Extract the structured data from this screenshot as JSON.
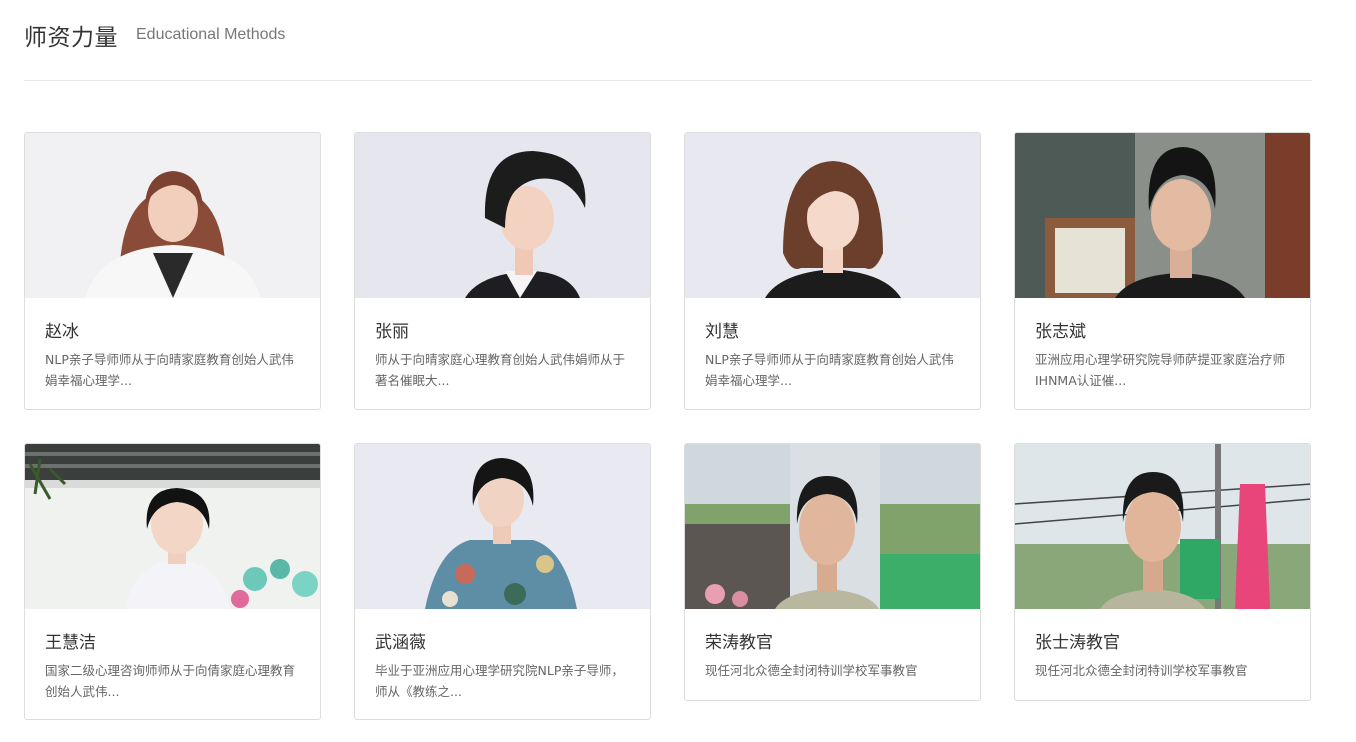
{
  "section": {
    "title": "师资力量",
    "subtitle": "Educational Methods"
  },
  "teachers": [
    {
      "name": "赵冰",
      "desc": "NLP亲子导师师从于向晴家庭教育创始人武伟娟幸福心理学..."
    },
    {
      "name": "张丽",
      "desc": "师从于向晴家庭心理教育创始人武伟娟师从于著名催眠大..."
    },
    {
      "name": "刘慧",
      "desc": "NLP亲子导师师从于向晴家庭教育创始人武伟娟幸福心理学..."
    },
    {
      "name": "张志斌",
      "desc": "亚洲应用心理学研究院导师萨提亚家庭治疗师IHNMA认证催..."
    },
    {
      "name": "王慧洁",
      "desc": "国家二级心理咨询师师从于向倩家庭心理教育创始人武伟..."
    },
    {
      "name": "武涵薇",
      "desc": "毕业于亚洲应用心理学研究院NLP亲子导师，师从《教练之..."
    },
    {
      "name": "荣涛教官",
      "desc": "现任河北众德全封闭特训学校军事教官"
    },
    {
      "name": "张士涛教官",
      "desc": "现任河北众德全封闭特训学校军事教官"
    }
  ],
  "colors": {
    "border": "#dddddd",
    "title": "#333333",
    "desc": "#666666"
  }
}
